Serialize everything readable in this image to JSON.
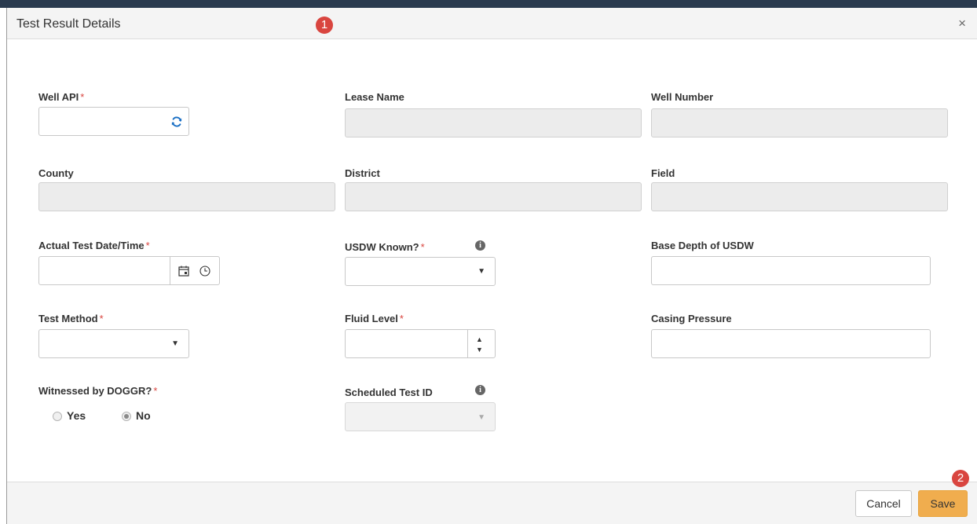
{
  "dialog": {
    "title": "Test Result Details",
    "close_glyph": "×"
  },
  "annotations": {
    "badge_1": "1",
    "badge_2": "2"
  },
  "required_marker": "*",
  "fields": {
    "well_api": {
      "label": "Well API",
      "value": "",
      "icon": "refresh-icon"
    },
    "lease_name": {
      "label": "Lease Name",
      "value": ""
    },
    "well_number": {
      "label": "Well Number",
      "value": ""
    },
    "county": {
      "label": "County",
      "value": ""
    },
    "district": {
      "label": "District",
      "value": ""
    },
    "field": {
      "label": "Field",
      "value": ""
    },
    "actual_test_datetime": {
      "label": "Actual Test Date/Time",
      "value": "",
      "icons": [
        "calendar-icon",
        "clock-icon"
      ]
    },
    "usdw_known": {
      "label": "USDW Known?",
      "value": "",
      "info_glyph": "i"
    },
    "base_depth_usdw": {
      "label": "Base Depth of USDW",
      "value": ""
    },
    "test_method": {
      "label": "Test Method",
      "value": ""
    },
    "fluid_level": {
      "label": "Fluid Level",
      "value": ""
    },
    "casing_pressure": {
      "label": "Casing Pressure",
      "value": ""
    },
    "witnessed_by_doggr": {
      "label": "Witnessed by DOGGR?",
      "options": [
        "Yes",
        "No"
      ],
      "selected": "No"
    },
    "scheduled_test_id": {
      "label": "Scheduled Test ID",
      "value": "",
      "info_glyph": "i"
    }
  },
  "footer": {
    "cancel_label": "Cancel",
    "save_label": "Save"
  },
  "colors": {
    "required": "#d9453f",
    "save_button": "#f0ad4e",
    "refresh_icon": "#1a6fc4",
    "badge": "#d9453f"
  }
}
